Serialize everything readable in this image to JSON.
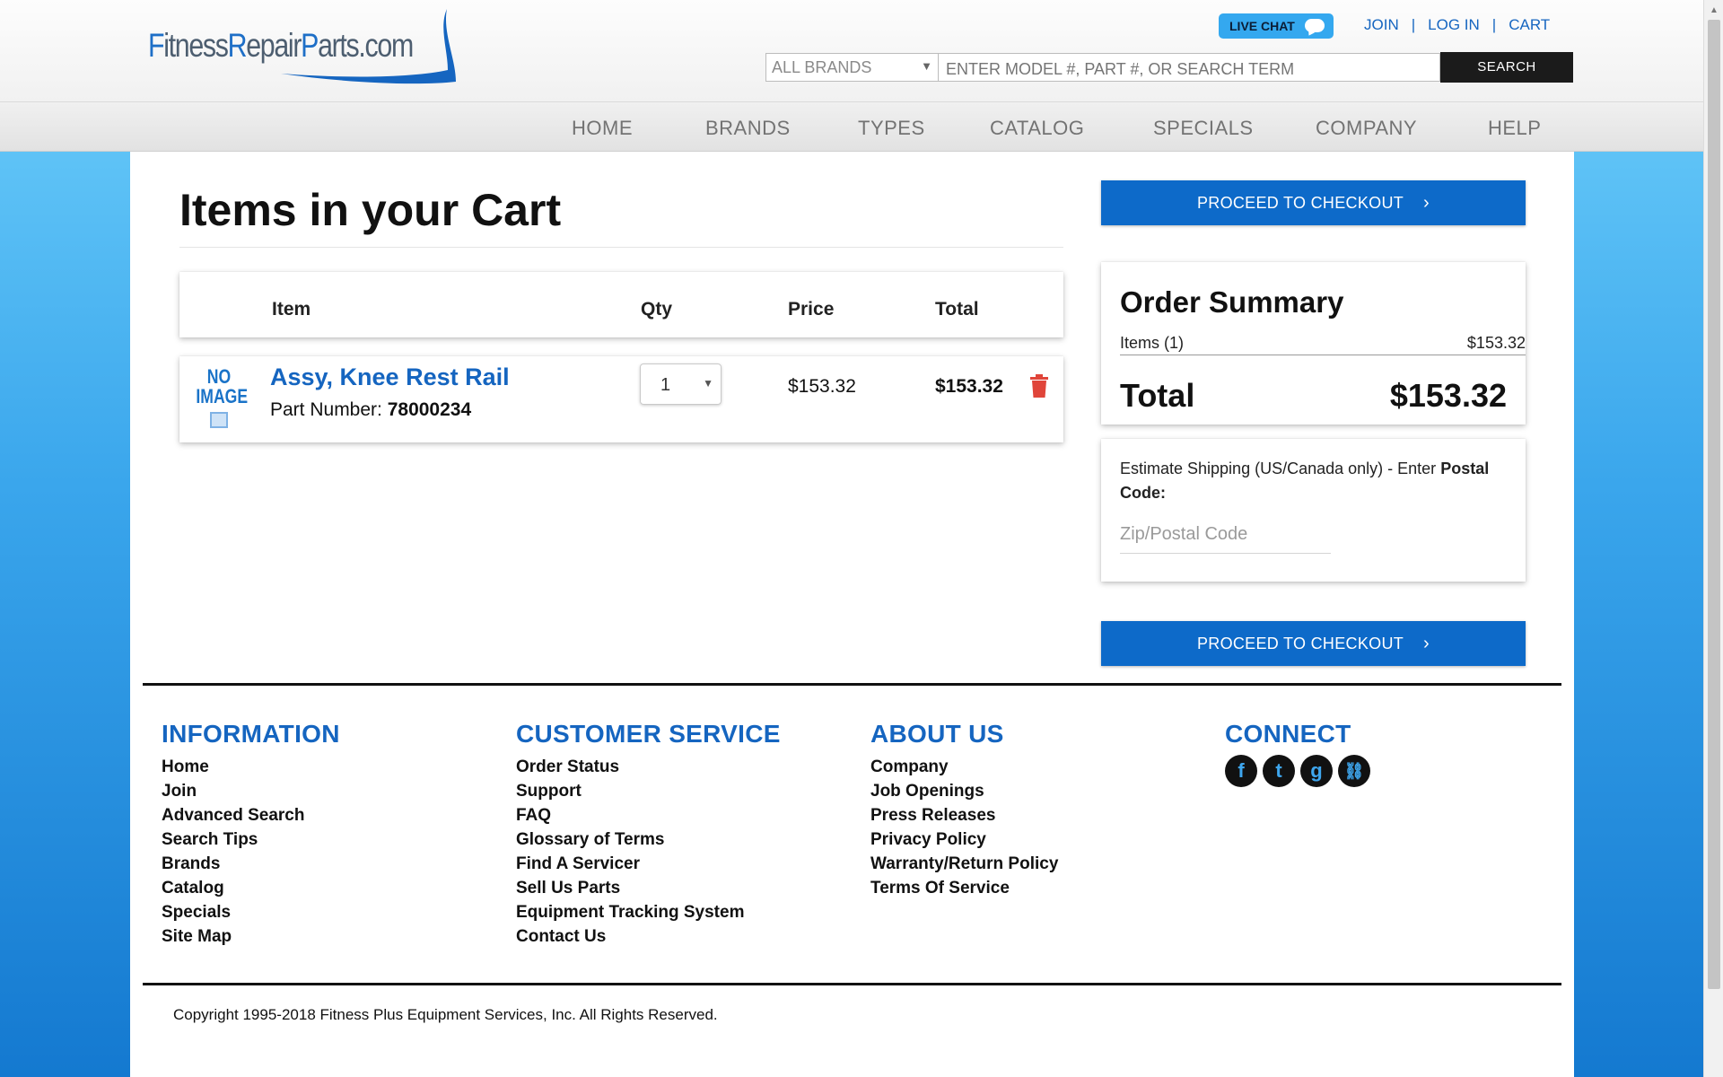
{
  "header": {
    "logo_text": "FitnessRepairParts.com",
    "live_chat": "LIVE CHAT",
    "links": {
      "join": "JOIN",
      "login": "LOG IN",
      "cart": "CART",
      "separator": "|"
    },
    "brand_select": "ALL BRANDS",
    "search_placeholder": "ENTER MODEL #, PART #, OR SEARCH TERM",
    "search_button": "SEARCH"
  },
  "nav": [
    "HOME",
    "BRANDS",
    "TYPES",
    "CATALOG",
    "SPECIALS",
    "COMPANY",
    "HELP"
  ],
  "cart": {
    "title": "Items in your Cart",
    "columns": {
      "item": "Item",
      "qty": "Qty",
      "price": "Price",
      "total": "Total"
    },
    "items": [
      {
        "image_text_1": "NO",
        "image_text_2": "IMAGE",
        "name": "Assy, Knee Rest Rail",
        "part_label": "Part Number:",
        "part_number": "78000234",
        "qty": "1",
        "price": "$153.32",
        "total": "$153.32"
      }
    ]
  },
  "checkout_button": "PROCEED TO CHECKOUT",
  "order_summary": {
    "title": "Order Summary",
    "items_label": "Items (1)",
    "items_value": "$153.32",
    "total_label": "Total",
    "total_value": "$153.32"
  },
  "shipping": {
    "text": "Estimate Shipping (US/Canada only) - Enter",
    "text_bold": "Postal Code:",
    "zip_placeholder": "Zip/Postal Code"
  },
  "footer": {
    "columns": [
      {
        "heading": "INFORMATION",
        "links": [
          "Home",
          "Join",
          "Advanced Search",
          "Search Tips",
          "Brands",
          "Catalog",
          "Specials",
          "Site Map"
        ]
      },
      {
        "heading": "CUSTOMER SERVICE",
        "links": [
          "Order Status",
          "Support",
          "FAQ",
          "Glossary of Terms",
          "Find A Servicer",
          "Sell Us Parts",
          "Equipment Tracking System",
          "Contact Us"
        ]
      },
      {
        "heading": "ABOUT US",
        "links": [
          "Company",
          "Job Openings",
          "Press Releases",
          "Privacy Policy",
          "Warranty/Return Policy",
          "Terms Of Service"
        ]
      },
      {
        "heading": "CONNECT",
        "links": []
      }
    ],
    "social": [
      {
        "name": "facebook-icon",
        "glyph": "f"
      },
      {
        "name": "twitter-icon",
        "glyph": "t"
      },
      {
        "name": "google-icon",
        "glyph": "g"
      },
      {
        "name": "link-icon",
        "glyph": "⛓"
      }
    ],
    "copyright": "Copyright 1995-2018 Fitness Plus Equipment Services, Inc. All Rights Reserved."
  }
}
